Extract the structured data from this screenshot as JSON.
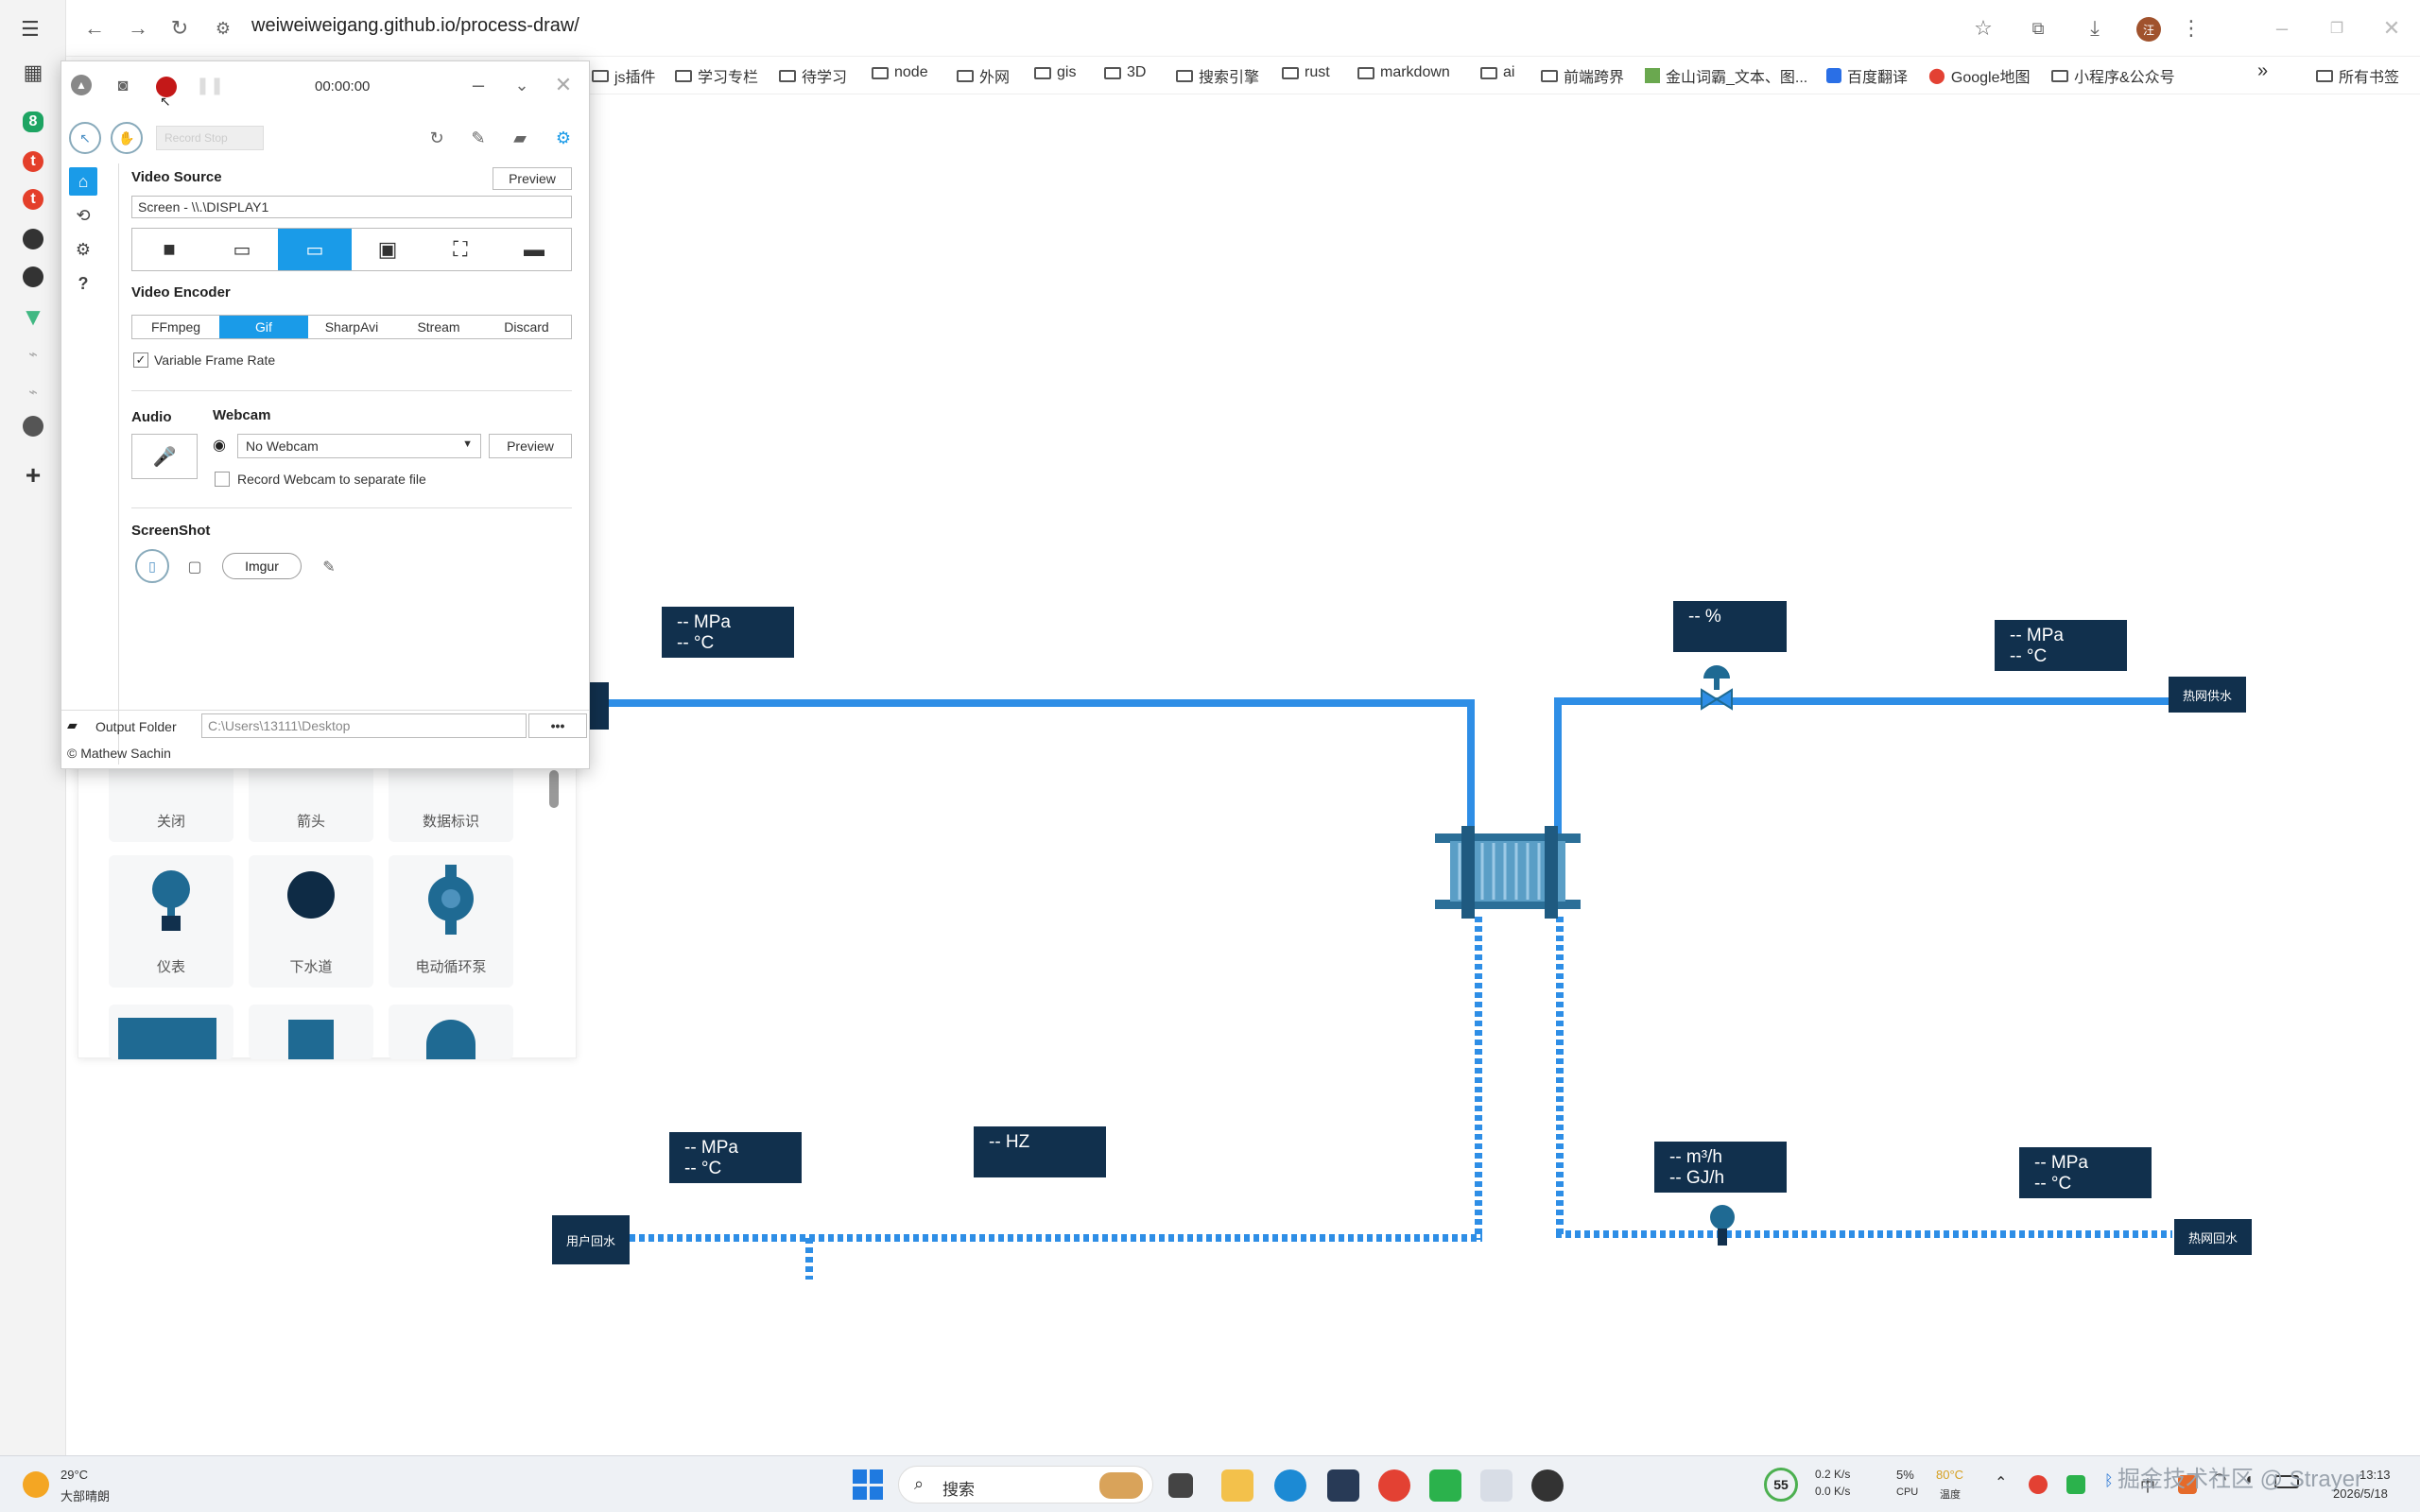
{
  "browser": {
    "url": "weiweiweigang.github.io/process-draw/",
    "profile_initial": "汪",
    "bookmarks": [
      "js插件",
      "学习专栏",
      "待学习",
      "node",
      "外网",
      "gis",
      "3D",
      "搜索引擎",
      "rust",
      "markdown",
      "ai",
      "前端跨界",
      "金山词霸_文本、图...",
      "百度翻译",
      "Google地图",
      "小程序&公众号"
    ],
    "bookmarks_more": "»",
    "bookmarks_all": "所有书签"
  },
  "capture": {
    "timer": "00:00:00",
    "overlay_text": "Record  Stop",
    "video_source_title": "Video Source",
    "preview_label": "Preview",
    "source_value": "Screen - \\\\.\\DISPLAY1",
    "video_encoder_title": "Video Encoder",
    "encoders": [
      "FFmpeg",
      "Gif",
      "SharpAvi",
      "Stream",
      "Discard"
    ],
    "encoder_selected": "Gif",
    "vfr_label": "Variable Frame Rate",
    "vfr_checked": true,
    "audio_title": "Audio",
    "webcam_title": "Webcam",
    "webcam_value": "No Webcam",
    "webcam_preview": "Preview",
    "webcam_separate_label": "Record Webcam to separate file",
    "screenshot_title": "ScreenShot",
    "imgur_label": "Imgur",
    "output_folder_label": "Output Folder",
    "output_folder_path": "C:\\Users\\13111\\Desktop",
    "more_label": "•••",
    "copyright": "© Mathew Sachin"
  },
  "palette": {
    "row1": [
      "关闭",
      "箭头",
      "数据标识"
    ],
    "row2": [
      "仪表",
      "下水道",
      "电动循环泵"
    ]
  },
  "diagram": {
    "meters": {
      "m1": [
        "-- MPa",
        "-- °C"
      ],
      "m2": [
        "-- %"
      ],
      "m3": [
        "-- MPa",
        "-- °C"
      ],
      "m4": [
        "-- MPa",
        "-- °C"
      ],
      "m5": [
        "-- HZ"
      ],
      "m6": [
        "-- m³/h",
        "-- GJ/h"
      ],
      "m7": [
        "-- MPa",
        "-- °C"
      ]
    },
    "labels": {
      "supply": "热网供水",
      "user_return": "用户回水",
      "return": "热网回水"
    },
    "pipe_color": "#2e8ee6",
    "box_color": "#11304d"
  },
  "taskbar": {
    "weather_temp": "29°C",
    "weather_desc": "大部晴朗",
    "search_placeholder": "搜索",
    "net_up": "0.2 K/s",
    "net_down": "0.0 K/s",
    "cpu_gauge": "55",
    "cpu_pct": "5%",
    "cpu_label": "CPU",
    "temp_val": "80°C",
    "temp_label": "温度",
    "ime": "中",
    "time": "13:13",
    "date": "2026/5/18",
    "watermark": "掘金技术社区 @ Strayer"
  }
}
